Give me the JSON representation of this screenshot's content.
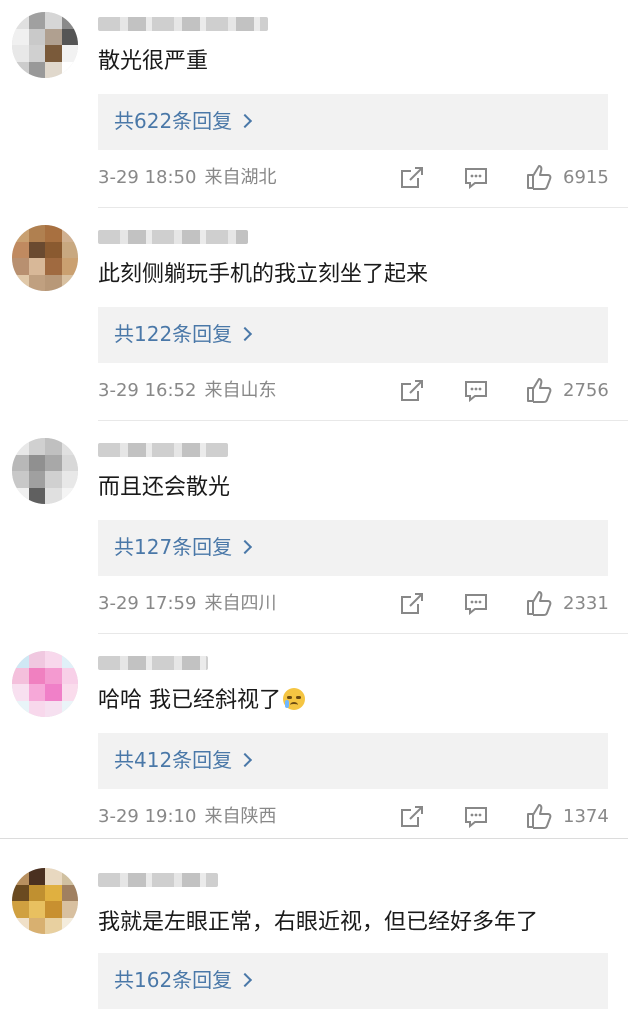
{
  "comments": [
    {
      "text": "散光很严重",
      "replies": "共622条回复",
      "date": "3-29 18:50",
      "location": "来自湖北",
      "likes": "6915",
      "avatar_colors": [
        "#e0e0e0",
        "#a0a0a0",
        "#d6d6d6",
        "#8a8a8a",
        "#f0f0f0",
        "#c9c9c9",
        "#b0a090",
        "#555555",
        "#e8e8e8",
        "#d0d0d0",
        "#7a5a3a",
        "#f2f2f2",
        "#cccccc",
        "#999999",
        "#e0d8cc",
        "#ffffff"
      ]
    },
    {
      "text": "此刻侧躺玩手机的我立刻坐了起来",
      "replies": "共122条回复",
      "date": "3-29 16:52",
      "location": "来自山东",
      "likes": "2756",
      "avatar_colors": [
        "#c9a070",
        "#b08050",
        "#a87040",
        "#d0b090",
        "#c08a60",
        "#6a4a30",
        "#8a5a30",
        "#c8a880",
        "#b89070",
        "#d8b898",
        "#a06a40",
        "#caa070",
        "#e0c8a8",
        "#c0a080",
        "#b89878",
        "#d8c0a0"
      ]
    },
    {
      "text": "而且还会散光",
      "replies": "共127条回复",
      "date": "3-29 17:59",
      "location": "来自四川",
      "likes": "2331",
      "avatar_colors": [
        "#e8e8e8",
        "#d0d0d0",
        "#c0c0c0",
        "#e0e0e0",
        "#b8b8b8",
        "#909090",
        "#a8a8a8",
        "#d8d8d8",
        "#c8c8c8",
        "#a0a0a0",
        "#d0d0d0",
        "#e8e8e8",
        "#f0f0f0",
        "#606060",
        "#e0e0e0",
        "#f4f4f4"
      ]
    },
    {
      "text": "哈哈 我已经斜视了",
      "replies": "共412条回复",
      "date": "3-29 19:10",
      "location": "来自陕西",
      "likes": "1374",
      "has_emoji": true,
      "avatar_colors": [
        "#cfe8f4",
        "#f0c8e0",
        "#f8d8ec",
        "#e0f0f8",
        "#f4c0dc",
        "#f080c0",
        "#f49ad0",
        "#f8d0e8",
        "#f8e0f0",
        "#f6a8d8",
        "#f080c8",
        "#fadcec",
        "#e8f4f8",
        "#f8d8ec",
        "#f6e0f0",
        "#eaf4f8"
      ]
    },
    {
      "text": "我就是左眼正常，右眼近视，但已经好多年了",
      "replies": "共162条回复",
      "avatar_colors": [
        "#b89060",
        "#4a3020",
        "#e8d8c0",
        "#d0c0a0",
        "#6a4a20",
        "#c09030",
        "#e0b040",
        "#a08060",
        "#d0a040",
        "#e8c060",
        "#c89030",
        "#d8c0a0",
        "#f0e0c8",
        "#d8b070",
        "#e8d0a0",
        "#f4ecdc"
      ]
    }
  ],
  "icons": {
    "share": "share-icon",
    "comment": "comment-icon",
    "like": "like-icon",
    "chevron": "chevron-right-icon"
  }
}
